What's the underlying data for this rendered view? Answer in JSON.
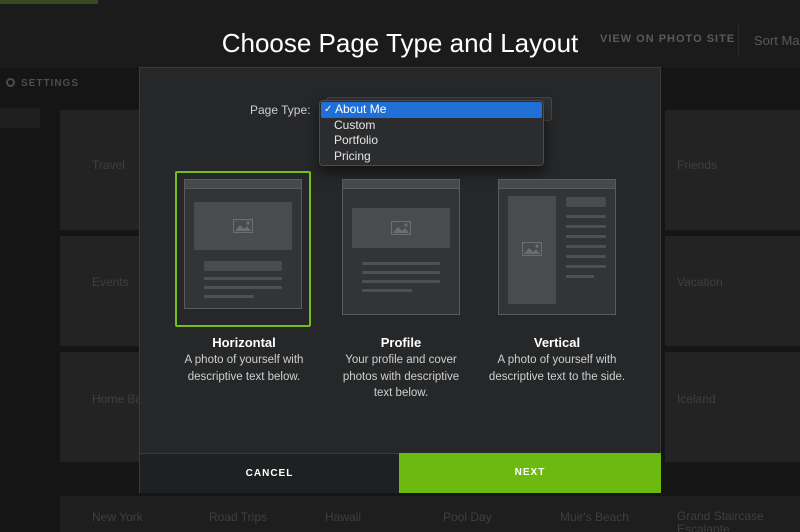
{
  "window": {
    "title": "Choose Page Type and Layout"
  },
  "background": {
    "nav_view_on_photo_site": "VIEW ON PHOTO SITE",
    "nav_sort": "Sort Ma",
    "settings": "SETTINGS",
    "gallery_labels": [
      "Travel",
      "Events",
      "Home Ba",
      "Friends",
      "Vacation",
      "Iceland",
      "New York",
      "Road Trips",
      "Hawaii",
      "Pool Day",
      "Muir's Beach",
      "Grand Staircase Escalante"
    ]
  },
  "dialog": {
    "page_type_label": "Page Type:",
    "dropdown": {
      "selected": "About Me",
      "options": [
        "About Me",
        "Custom",
        "Portfolio",
        "Pricing"
      ]
    },
    "layouts": [
      {
        "title": "Horizontal",
        "description": "A photo of yourself with descriptive text below.",
        "selected": true
      },
      {
        "title": "Profile",
        "description": "Your profile and cover photos with descriptive text below.",
        "selected": false
      },
      {
        "title": "Vertical",
        "description": "A photo of yourself with descriptive text to the side.",
        "selected": false
      }
    ],
    "cancel_label": "CANCEL",
    "next_label": "NEXT"
  },
  "colors": {
    "accent": "#6cba0f",
    "selection_blue": "#1f6fd6",
    "dialog_bg": "#262728"
  },
  "icons": [
    "gear-icon",
    "checkmark-icon",
    "image-placeholder-icon"
  ]
}
